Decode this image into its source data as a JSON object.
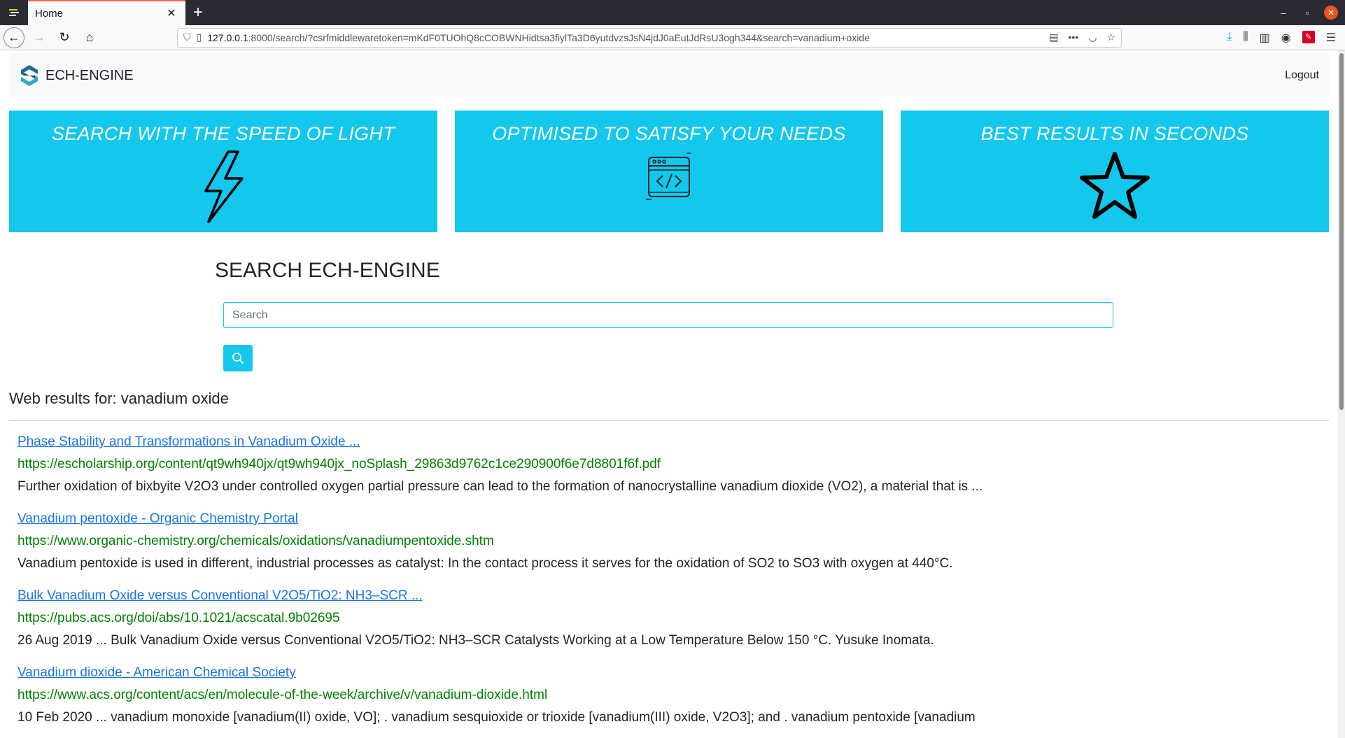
{
  "browser": {
    "tab_title": "Home",
    "url_host": "127.0.0.1",
    "url_rest": ":8000/search/?csrfmiddlewaretoken=mKdF0TUOhQ8cCOBWNHidtsa3fiylTa3D6yutdvzsJsN4jdJ0aEutJdRsU3ogh344&search=vanadium+oxide"
  },
  "site": {
    "brand": "ECH-ENGINE",
    "logout": "Logout"
  },
  "features": [
    {
      "title": "SEARCH WITH THE SPEED OF LIGHT",
      "icon": "lightning-icon"
    },
    {
      "title": "OPTIMISED TO SATISFY YOUR NEEDS",
      "icon": "code-window-icon"
    },
    {
      "title": "BEST RESULTS IN SECONDS",
      "icon": "star-icon"
    }
  ],
  "search": {
    "title": "SEARCH ECH-ENGINE",
    "placeholder": "Search",
    "value": ""
  },
  "results_heading": "Web results for: vanadium oxide",
  "results": [
    {
      "title": "Phase Stability and Transformations in Vanadium Oxide ...",
      "url": "https://escholarship.org/content/qt9wh940jx/qt9wh940jx_noSplash_29863d9762c1ce290900f6e7d8801f6f.pdf",
      "snippet": "Further oxidation of bixbyite V2O3 under controlled oxygen partial pressure can lead to the formation of nanocrystalline vanadium dioxide (VO2), a material that is  ..."
    },
    {
      "title": "Vanadium pentoxide - Organic Chemistry Portal",
      "url": "https://www.organic-chemistry.org/chemicals/oxidations/vanadiumpentoxide.shtm",
      "snippet": "Vanadium pentoxide is used in different, industrial processes as catalyst: In the contact process it serves for the oxidation of SO2 to SO3 with oxygen at 440°C."
    },
    {
      "title": "Bulk Vanadium Oxide versus Conventional V2O5/TiO2: NH3–SCR ...",
      "url": "https://pubs.acs.org/doi/abs/10.1021/acscatal.9b02695",
      "snippet": "26 Aug 2019 ... Bulk Vanadium Oxide versus Conventional V2O5/TiO2: NH3–SCR Catalysts Working at a Low Temperature Below 150 °C. Yusuke Inomata."
    },
    {
      "title": "Vanadium dioxide - American Chemical Society",
      "url": "https://www.acs.org/content/acs/en/molecule-of-the-week/archive/v/vanadium-dioxide.html",
      "snippet": "10 Feb 2020 ... vanadium monoxide [vanadium(II) oxide, VO]; . vanadium sesquioxide or trioxide [vanadium(III) oxide, V2O3]; and . vanadium pentoxide [vanadium"
    }
  ],
  "colors": {
    "accent": "#13c7ed",
    "link": "#1a73e8",
    "url": "#008000"
  }
}
